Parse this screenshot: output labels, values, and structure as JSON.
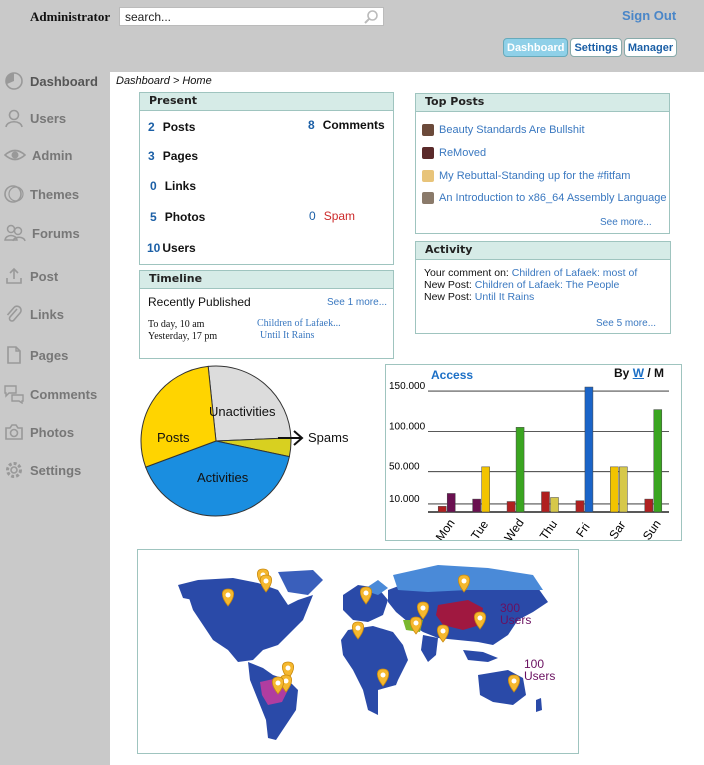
{
  "header": {
    "brand": "Administrator",
    "search_placeholder": "search...",
    "signout": "Sign Out",
    "tabs": [
      {
        "label": "Dashboard",
        "active": true
      },
      {
        "label": "Settings",
        "active": false
      },
      {
        "label": "Manager",
        "active": false
      }
    ]
  },
  "sidebar": {
    "items": [
      {
        "label": "Dashboard",
        "icon": "dashboard-icon"
      },
      {
        "label": "Users",
        "icon": "user-icon"
      },
      {
        "label": "Admin",
        "icon": "eye-icon"
      },
      {
        "label": "Themes",
        "icon": "themes-icon"
      },
      {
        "label": "Forums",
        "icon": "forums-icon"
      },
      {
        "label": "Post",
        "icon": "upload-icon"
      },
      {
        "label": "Links",
        "icon": "paperclip-icon"
      },
      {
        "label": "Pages",
        "icon": "page-icon"
      },
      {
        "label": "Comments",
        "icon": "comments-icon"
      },
      {
        "label": "Photos",
        "icon": "camera-icon"
      },
      {
        "label": "Settings",
        "icon": "gear-icon"
      }
    ]
  },
  "breadcrumb": "Dashboard > Home",
  "present": {
    "title": "Present",
    "posts": {
      "n": "2",
      "label": "Posts"
    },
    "pages": {
      "n": "3",
      "label": "Pages"
    },
    "links": {
      "n": "0",
      "label": "Links"
    },
    "photos": {
      "n": "5",
      "label": "Photos"
    },
    "users": {
      "n": "10",
      "label": "Users"
    },
    "comments": {
      "n": "8",
      "label": "Comments"
    },
    "spam": {
      "n": "0",
      "label": "Spam"
    }
  },
  "top_posts": {
    "title": "Top Posts",
    "items": [
      "Beauty Standards Are Bullshit",
      "ReMoved",
      "My Rebuttal-Standing up for the #fitfam",
      "An Introduction to x86_64 Assembly Language"
    ],
    "see_more": "See more..."
  },
  "timeline": {
    "title": "Timeline",
    "subtitle": "Recently Published",
    "see_more": "See 1 more...",
    "rows": [
      {
        "time": "To day, 10 am",
        "title": "Children of Lafaek..."
      },
      {
        "time": "Yesterday, 17 pm",
        "title": "Until It Rains"
      }
    ]
  },
  "activity": {
    "title": "Activity",
    "lines": [
      {
        "prefix": "Your comment on:",
        "link": "Children of Lafaek: most of"
      },
      {
        "prefix": "New Post:",
        "link": "Children of Lafaek: The People"
      },
      {
        "prefix": "New Post:",
        "link": "Until It Rains"
      }
    ],
    "see_more": "See 5 more..."
  },
  "pie": {
    "labels": {
      "unactivities": "Unactivities",
      "posts": "Posts",
      "activities": "Activities",
      "spams": "Spams"
    },
    "colors": {
      "posts": "#ffd400",
      "unactivities": "#dcdcdc",
      "activities": "#1a8ee0",
      "spams": "#d8d020"
    }
  },
  "access": {
    "title": "Access",
    "by_label": "By",
    "w_label": "W",
    "sep": "/",
    "m_label": "M"
  },
  "chart_data": [
    {
      "type": "pie",
      "categories": [
        "Unactivities",
        "Posts",
        "Activities",
        "Spams"
      ],
      "values": [
        26,
        29,
        41,
        4
      ]
    },
    {
      "type": "bar",
      "title": "Access",
      "categories": [
        "Mon",
        "Tue",
        "Wed",
        "Thu",
        "Fri",
        "Sar",
        "Sun"
      ],
      "ylim": [
        0,
        160000
      ],
      "yticks": [
        "150.000",
        "100.000",
        "50.000",
        "10.000"
      ],
      "ytick_values": [
        150000,
        100000,
        50000,
        10000
      ],
      "grid": true,
      "series": [
        {
          "values": [
            7000,
            0,
            13000,
            25000,
            14000,
            0,
            16000
          ],
          "color": "#b02020"
        },
        {
          "values": [
            23000,
            16000,
            0,
            0,
            0,
            0,
            0
          ],
          "color": "#6a1050"
        },
        {
          "values": [
            0,
            56000,
            0,
            0,
            0,
            56000,
            0
          ],
          "color": "#f2c400"
        },
        {
          "values": [
            0,
            0,
            105000,
            0,
            0,
            0,
            127000
          ],
          "color": "#3aa520"
        },
        {
          "values": [
            0,
            0,
            0,
            0,
            155000,
            0,
            0
          ],
          "color": "#1a64c8"
        },
        {
          "values": [
            0,
            0,
            0,
            18000,
            0,
            56000,
            0
          ],
          "color": "#d6c84a"
        }
      ]
    }
  ],
  "map": {
    "labels": [
      {
        "text": "300 Users",
        "color": "#6a1060"
      },
      {
        "text": "100 Users",
        "color": "#6a1060"
      }
    ],
    "pin_color": "#f5b82e"
  }
}
